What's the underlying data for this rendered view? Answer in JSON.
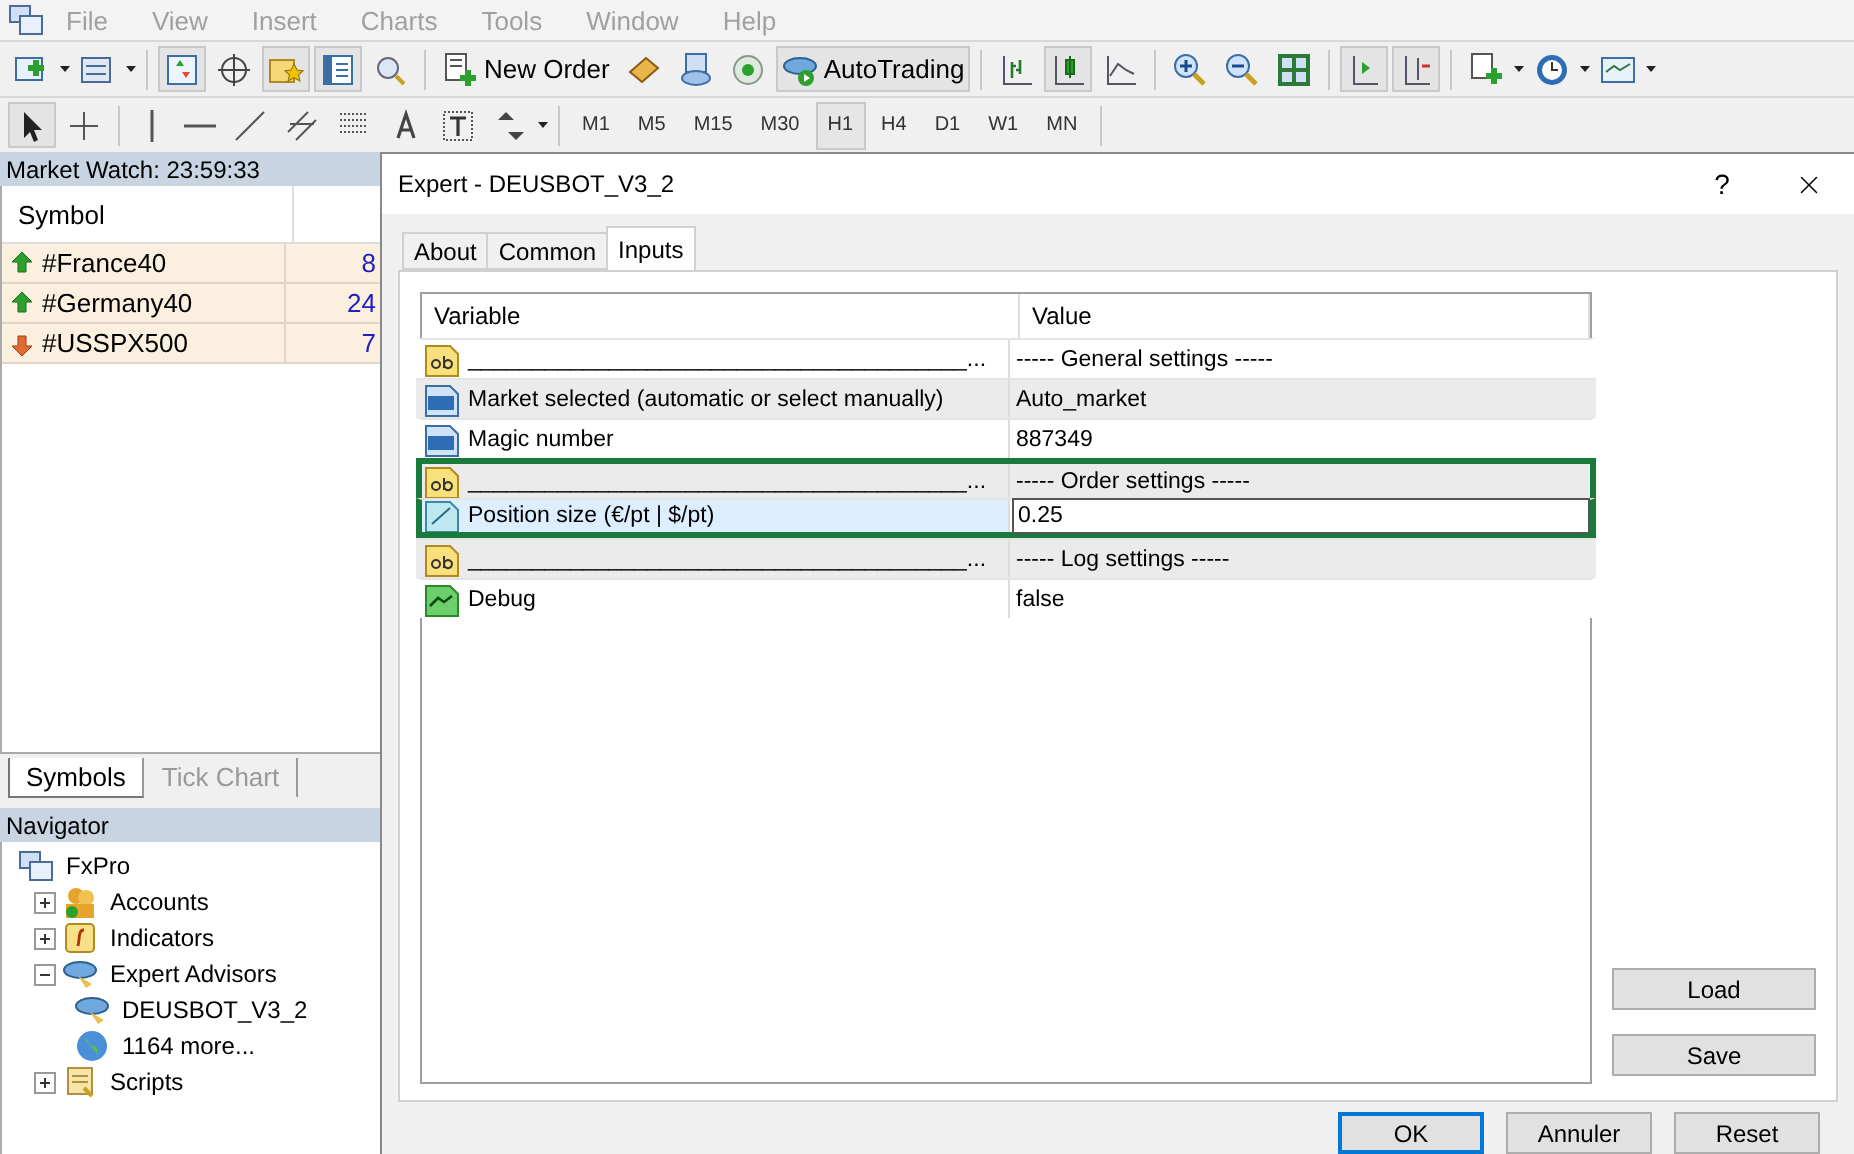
{
  "menu": [
    "File",
    "View",
    "Insert",
    "Charts",
    "Tools",
    "Window",
    "Help"
  ],
  "toolbar": {
    "new_order": "New Order",
    "auto_trading": "AutoTrading"
  },
  "timeframes": [
    {
      "label": "M1",
      "selected": false
    },
    {
      "label": "M5",
      "selected": false
    },
    {
      "label": "M15",
      "selected": false
    },
    {
      "label": "M30",
      "selected": false
    },
    {
      "label": "H1",
      "selected": true
    },
    {
      "label": "H4",
      "selected": false
    },
    {
      "label": "D1",
      "selected": false
    },
    {
      "label": "W1",
      "selected": false
    },
    {
      "label": "MN",
      "selected": false
    }
  ],
  "market_watch": {
    "title": "Market Watch: 23:59:33",
    "columns": [
      "Symbol"
    ],
    "rows": [
      {
        "symbol": "#France40",
        "column_2": "8",
        "kind": "up"
      },
      {
        "symbol": "#Germany40",
        "column_2": "24",
        "kind": "up"
      },
      {
        "symbol": "#USSPX500",
        "column_2": "7",
        "kind": "down"
      }
    ],
    "tabs": [
      {
        "label": "Symbols",
        "selected": true
      },
      {
        "label": "Tick Chart",
        "selected": false
      }
    ]
  },
  "navigator": {
    "title": "Navigator",
    "tree": [
      {
        "label": "FxPro",
        "kind": "terminal",
        "children": [
          {
            "label": "Accounts",
            "kind": "accounts",
            "expanded": false
          },
          {
            "label": "Indicators",
            "kind": "indicators",
            "expanded": false
          },
          {
            "label": "Expert Advisors",
            "kind": "experts",
            "expanded": true,
            "children": [
              {
                "label": "DEUSBOT_V3_2",
                "kind": "expert"
              },
              {
                "label": "1164 more...",
                "kind": "globe"
              }
            ]
          },
          {
            "label": "Scripts",
            "kind": "scripts",
            "expanded": false
          }
        ]
      }
    ]
  },
  "dialog": {
    "title": "Expert - DEUSBOT_V3_2",
    "help": "?",
    "tabs": [
      {
        "label": "About",
        "selected": false
      },
      {
        "label": "Common",
        "selected": false
      },
      {
        "label": "Inputs",
        "selected": true
      }
    ],
    "columns": [
      "Variable",
      "Value"
    ],
    "rows": [
      {
        "kind": "string",
        "variable": "_______________________________________...",
        "value": "----- General settings -----",
        "selected": false,
        "highlighted": false
      },
      {
        "kind": "integer",
        "variable": "Market selected (automatic or select manually)",
        "value": "Auto_market",
        "selected": false,
        "highlighted": false
      },
      {
        "kind": "integer",
        "variable": "Magic number",
        "value": "887349",
        "selected": false,
        "highlighted": false
      },
      {
        "kind": "string",
        "variable": "_______________________________________...",
        "value": "----- Order settings -----",
        "selected": false,
        "highlighted": true
      },
      {
        "kind": "double",
        "variable": "Position size (€/pt | $/pt)",
        "value": "0.25",
        "selected": true,
        "highlighted": true
      },
      {
        "kind": "string",
        "variable": "_______________________________________...",
        "value": "----- Log settings -----",
        "selected": false,
        "highlighted": false
      },
      {
        "kind": "bool",
        "variable": "Debug",
        "value": "false",
        "selected": false,
        "highlighted": false
      }
    ],
    "side_buttons": [
      "Load",
      "Save"
    ],
    "buttons": [
      {
        "label": "OK",
        "default": true
      },
      {
        "label": "Annuler",
        "default": false
      },
      {
        "label": "Reset",
        "default": false
      }
    ]
  }
}
